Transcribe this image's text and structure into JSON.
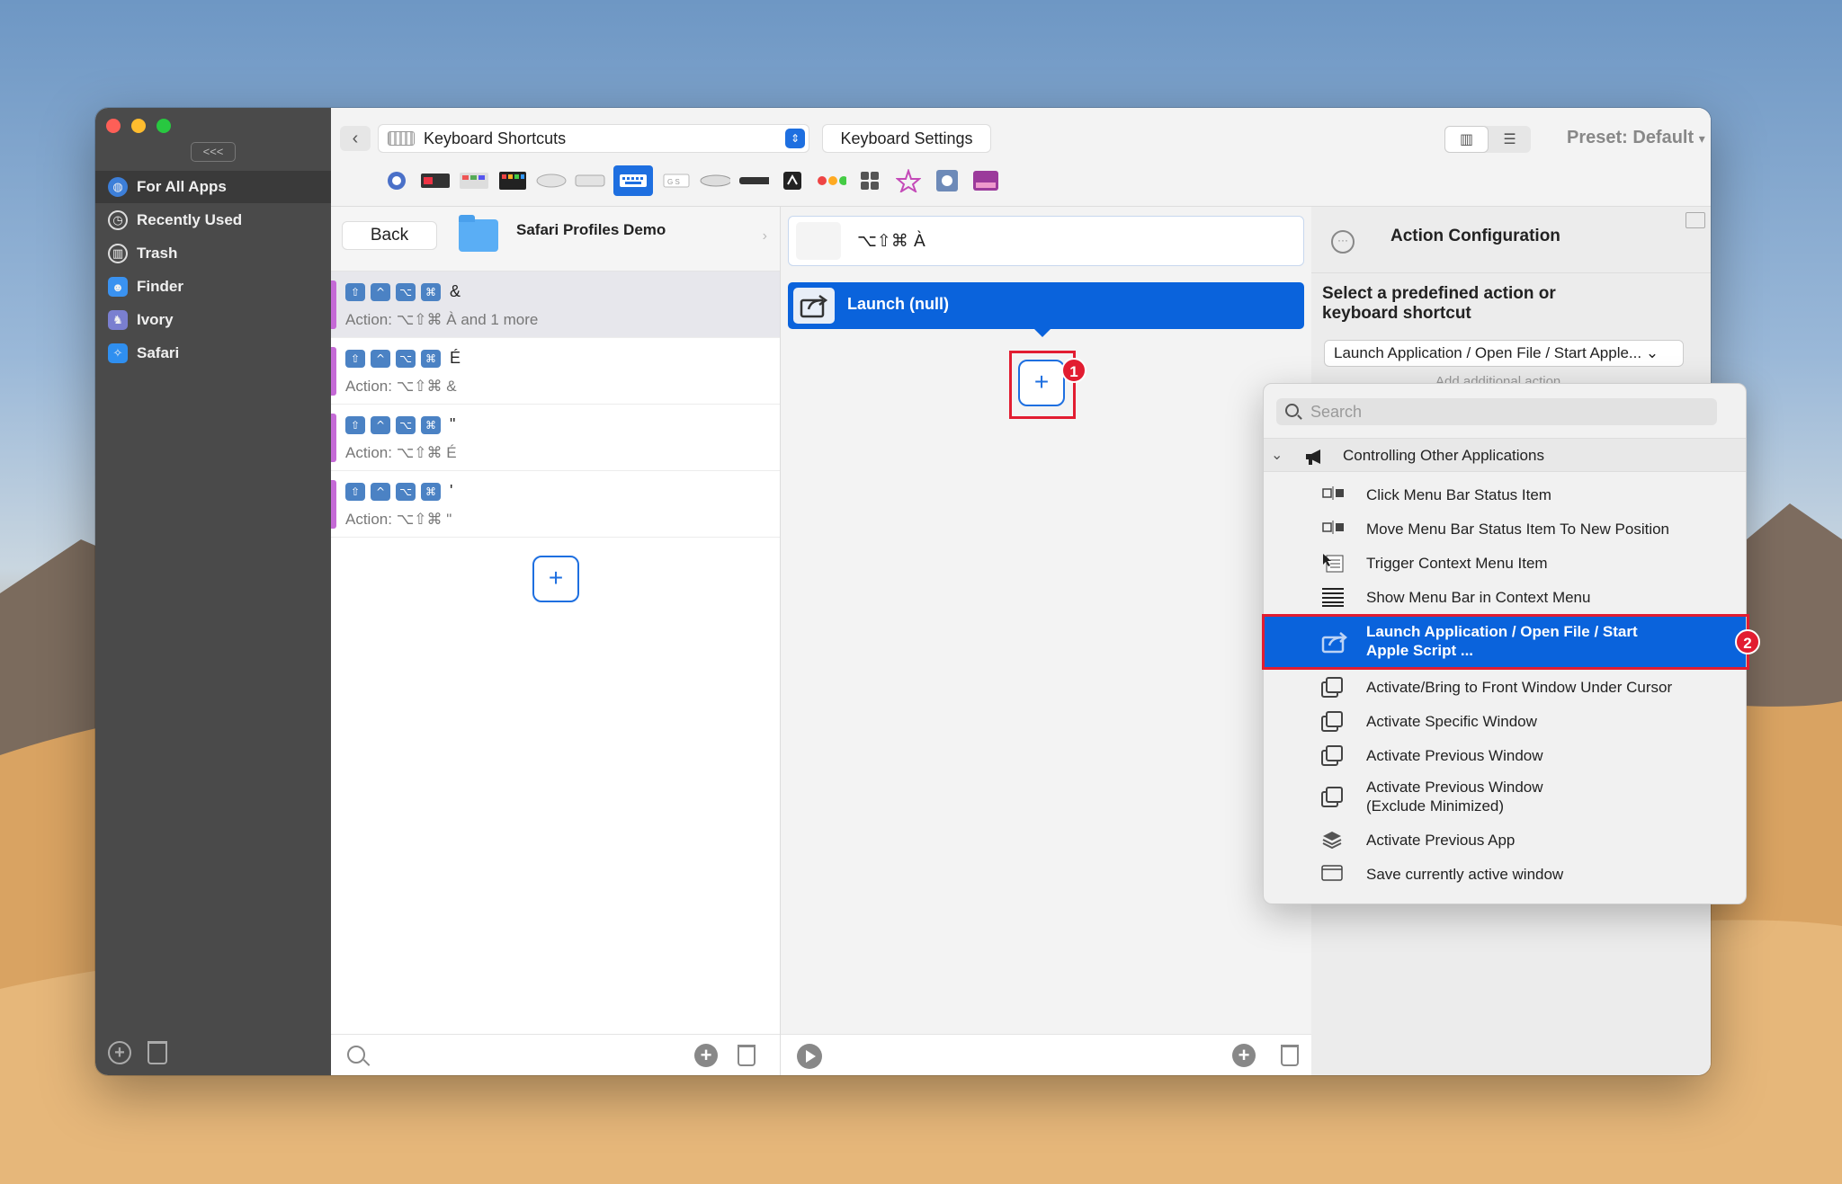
{
  "sidebar": {
    "collapse_label": "<<<",
    "items": [
      {
        "label": "For All Apps",
        "icon": "globe-icon"
      },
      {
        "label": "Recently Used",
        "icon": "clock-icon"
      },
      {
        "label": "Trash",
        "icon": "trash-icon"
      },
      {
        "label": "Finder",
        "icon": "finder-icon"
      },
      {
        "label": "Ivory",
        "icon": "ivory-icon"
      },
      {
        "label": "Safari",
        "icon": "safari-icon"
      }
    ]
  },
  "toolbar": {
    "trigger_type": "Keyboard Shortcuts",
    "settings_button": "Keyboard Settings",
    "preset": "Preset: Default",
    "preset_caret": "▾",
    "back_glyph": "‹",
    "more_glyph": "···"
  },
  "group": {
    "back_label": "Back",
    "name": "Safari Profiles Demo",
    "chevron": "›"
  },
  "triggers": [
    {
      "modifiers": [
        "⇧",
        "^",
        "⌥",
        "⌘"
      ],
      "char": "&",
      "action": "Action: ⌥⇧⌘ À and 1 more"
    },
    {
      "modifiers": [
        "⇧",
        "^",
        "⌥",
        "⌘"
      ],
      "char": "É",
      "action": "Action: ⌥⇧⌘ &"
    },
    {
      "modifiers": [
        "⇧",
        "^",
        "⌥",
        "⌘"
      ],
      "char": "\"",
      "action": "Action: ⌥⇧⌘ É"
    },
    {
      "modifiers": [
        "⇧",
        "^",
        "⌥",
        "⌘"
      ],
      "char": "'",
      "action": "Action: ⌥⇧⌘ \""
    }
  ],
  "add_glyph": "+",
  "middle": {
    "trigger_shortcut": "⌥⇧⌘ À",
    "action_label": "Launch (null)",
    "badge_1": "1"
  },
  "action_config": {
    "title": "Action Configuration",
    "select_label": "Select a predefined action or keyboard shortcut",
    "selected_action": "Launch Application / Open File / Start Apple... ⌄",
    "add_additional": "Add additional action"
  },
  "popup": {
    "search_placeholder": "Search",
    "category": "Controlling Other Applications",
    "category_chevron": "⌄",
    "items": [
      {
        "label": "Click Menu Bar Status Item",
        "icon": "menubar-status-icon"
      },
      {
        "label": "Move Menu Bar Status Item To New Position",
        "icon": "menubar-move-icon"
      },
      {
        "label": "Trigger Context Menu Item",
        "icon": "context-menu-icon"
      },
      {
        "label": "Show Menu Bar in Context Menu",
        "icon": "menu-lines-icon"
      },
      {
        "label": "Launch Application / Open File / Start Apple Script ...",
        "icon": "launch-icon",
        "selected": true
      },
      {
        "label": "Activate/Bring to Front Window Under Cursor",
        "icon": "windows-icon"
      },
      {
        "label": "Activate Specific Window",
        "icon": "windows-icon"
      },
      {
        "label": "Activate Previous Window",
        "icon": "windows-icon"
      },
      {
        "label": "Activate Previous Window (Exclude Minimized)",
        "icon": "windows-icon"
      },
      {
        "label": "Activate Previous App",
        "icon": "layers-icon"
      },
      {
        "label": "Save currently active window",
        "icon": "window-icon"
      }
    ],
    "badge_2": "2"
  },
  "colors": {
    "accent": "#0a63dc",
    "highlight_red": "#e21d31",
    "sidebar_bg": "#4a4a4a",
    "trigger_bar": "#c56ad6"
  }
}
